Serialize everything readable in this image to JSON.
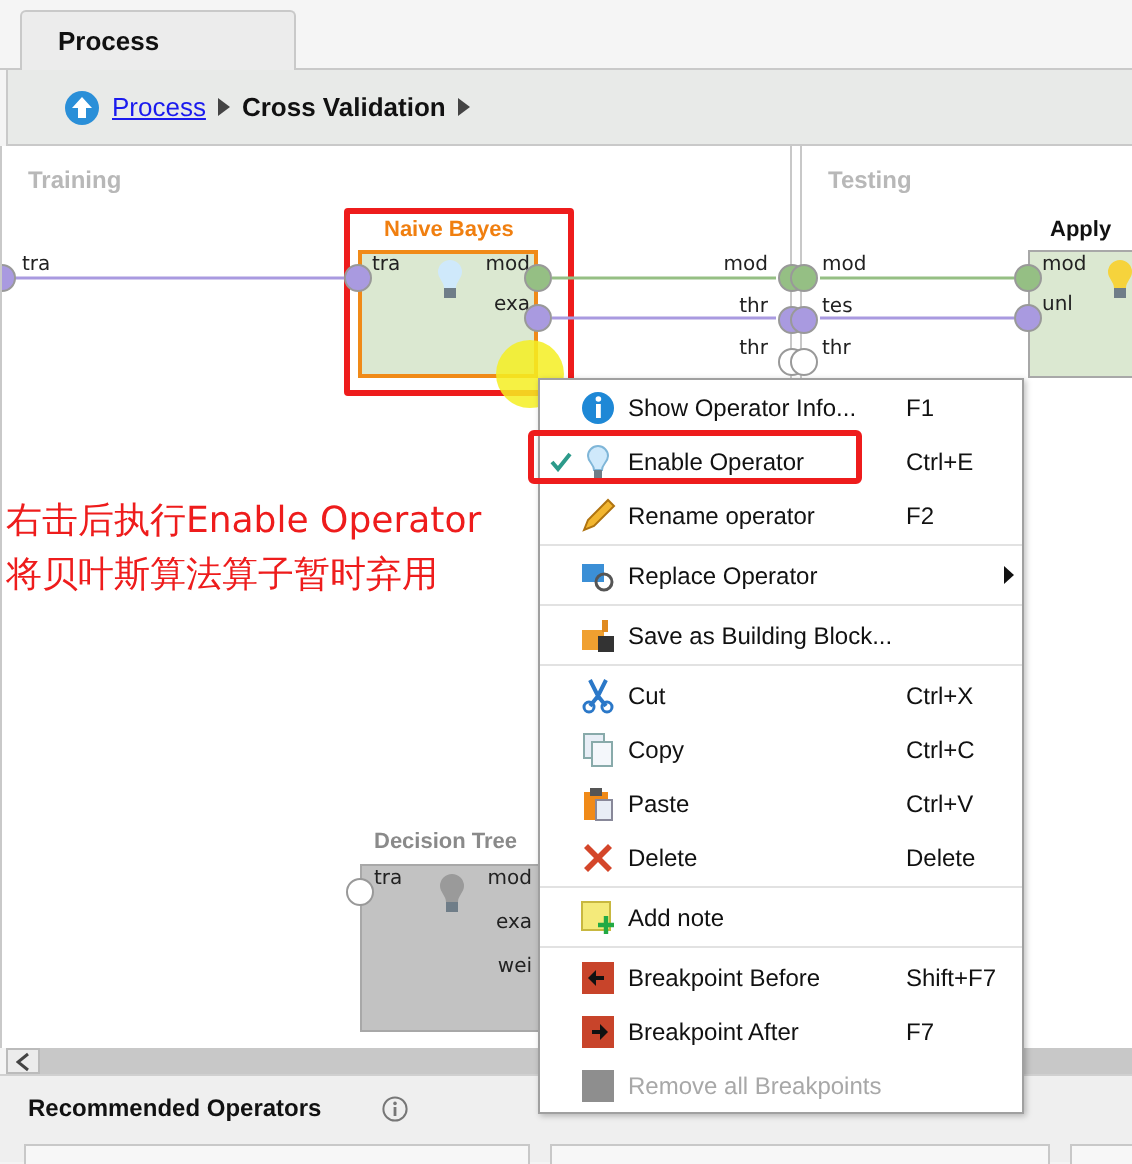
{
  "tab": {
    "label": "Process",
    "selected": true
  },
  "breadcrumb": [
    {
      "label": "Process",
      "kind": "link"
    },
    {
      "label": "Cross Validation",
      "kind": "current"
    }
  ],
  "canvas": {
    "sections": [
      "Training",
      "Testing"
    ],
    "left_ports": [
      "tra"
    ],
    "divider_outputs": [
      "mod",
      "thr",
      "thr"
    ],
    "divider_inputs": [
      "mod",
      "tes",
      "thr"
    ],
    "operators": [
      {
        "name": "Naive Bayes",
        "enabled": true,
        "highlighted": true,
        "inputs": [
          "tra"
        ],
        "outputs": [
          "mod",
          "exa"
        ]
      },
      {
        "name": "Apply",
        "enabled": true,
        "highlighted": false,
        "inputs": [
          "mod",
          "unl"
        ]
      },
      {
        "name": "Decision Tree",
        "enabled": false,
        "highlighted": false,
        "inputs": [
          "tra"
        ],
        "outputs": [
          "mod",
          "exa",
          "wei"
        ]
      }
    ]
  },
  "annotation": [
    "右击后执行Enable Operator",
    "将贝叶斯算法算子暂时弃用"
  ],
  "context_menu": [
    {
      "kind": "item",
      "label": "Show Operator Info...",
      "shortcut": "F1",
      "checked": false,
      "disabled": false,
      "highlighted": false
    },
    {
      "kind": "item",
      "label": "Enable Operator",
      "shortcut": "Ctrl+E",
      "checked": true,
      "disabled": false,
      "highlighted": true
    },
    {
      "kind": "item",
      "label": "Rename operator",
      "shortcut": "F2",
      "checked": false,
      "disabled": false,
      "highlighted": false
    },
    {
      "kind": "separator"
    },
    {
      "kind": "submenu",
      "label": "Replace Operator",
      "checked": false,
      "disabled": false,
      "highlighted": false
    },
    {
      "kind": "separator"
    },
    {
      "kind": "item",
      "label": "Save as Building Block...",
      "checked": false,
      "disabled": false,
      "highlighted": false
    },
    {
      "kind": "separator"
    },
    {
      "kind": "item",
      "label": "Cut",
      "shortcut": "Ctrl+X",
      "checked": false,
      "disabled": false,
      "highlighted": false
    },
    {
      "kind": "item",
      "label": "Copy",
      "shortcut": "Ctrl+C",
      "checked": false,
      "disabled": false,
      "highlighted": false
    },
    {
      "kind": "item",
      "label": "Paste",
      "shortcut": "Ctrl+V",
      "checked": false,
      "disabled": false,
      "highlighted": false
    },
    {
      "kind": "item",
      "label": "Delete",
      "shortcut": "Delete",
      "checked": false,
      "disabled": false,
      "highlighted": false
    },
    {
      "kind": "separator"
    },
    {
      "kind": "item",
      "label": "Add note",
      "checked": false,
      "disabled": false,
      "highlighted": false
    },
    {
      "kind": "separator"
    },
    {
      "kind": "item",
      "label": "Breakpoint Before",
      "shortcut": "Shift+F7",
      "checked": false,
      "disabled": false,
      "highlighted": false
    },
    {
      "kind": "item",
      "label": "Breakpoint After",
      "shortcut": "F7",
      "checked": false,
      "disabled": false,
      "highlighted": false
    },
    {
      "kind": "item",
      "label": "Remove all Breakpoints",
      "checked": false,
      "disabled": true,
      "highlighted": false
    }
  ],
  "bottom_panel": {
    "title": "Recommended Operators"
  }
}
